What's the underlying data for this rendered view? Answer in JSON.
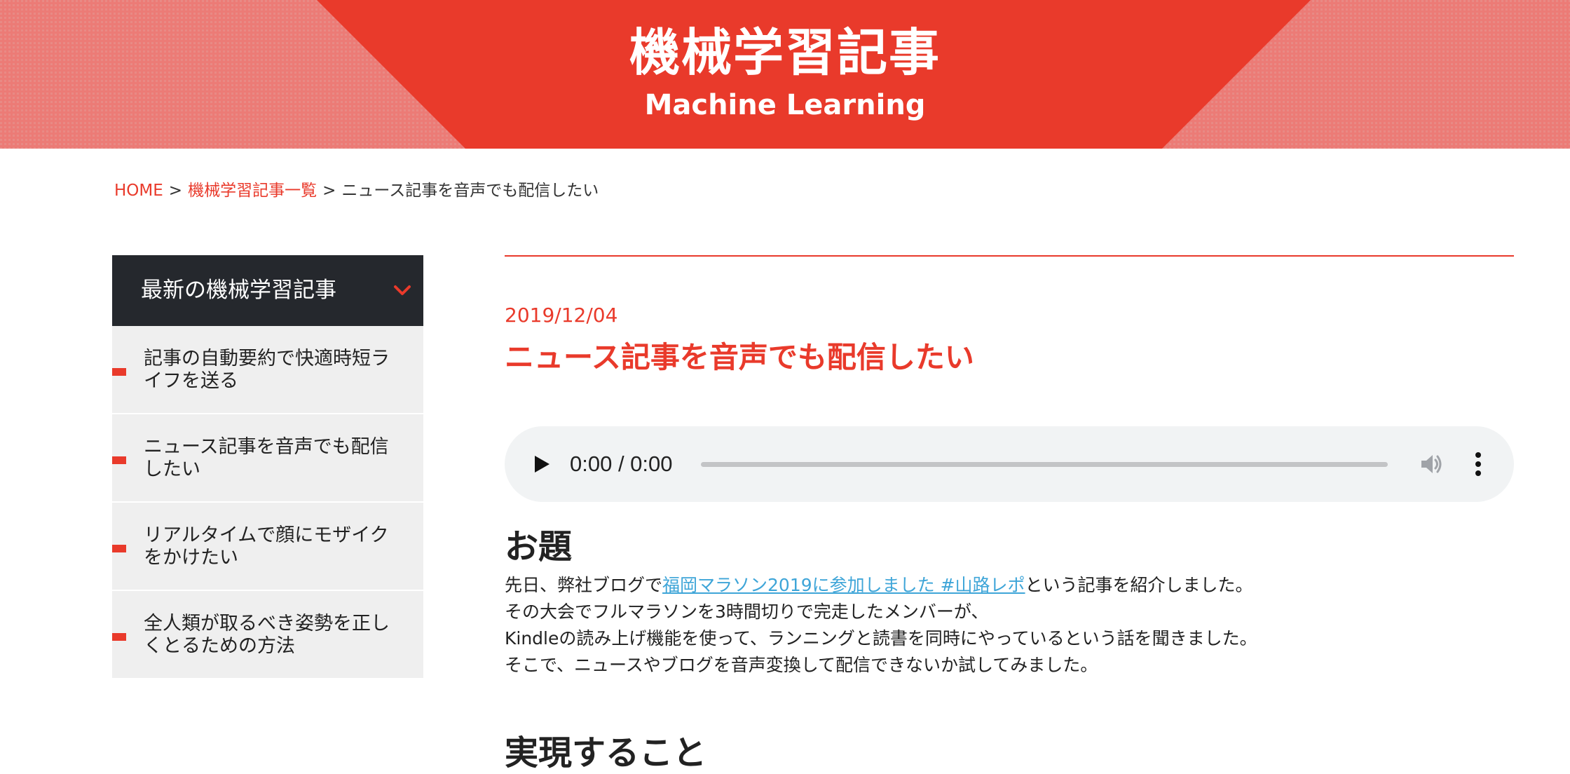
{
  "header": {
    "title": "機械学習記事",
    "subtitle": "Machine Learning"
  },
  "breadcrumb": {
    "home": "HOME",
    "separator": ">",
    "category": "機械学習記事一覧",
    "current": "ニュース記事を音声でも配信したい"
  },
  "sidebar": {
    "title": "最新の機械学習記事",
    "items": [
      {
        "label": "記事の自動要約で快適時短ライフを送る"
      },
      {
        "label": "ニュース記事を音声でも配信したい"
      },
      {
        "label": "リアルタイムで顔にモザイクをかけたい"
      },
      {
        "label": "全人類が取るべき姿勢を正しくとるための方法"
      }
    ]
  },
  "article": {
    "date": "2019/12/04",
    "title": "ニュース記事を音声でも配信したい",
    "player": {
      "time": "0:00 / 0:00",
      "progress": 0
    },
    "sections": [
      {
        "heading": "お題",
        "paragraph": {
          "line1_prefix": "先日、弊社ブログで",
          "line1_link": "福岡マラソン2019に参加しました #山路レポ",
          "line1_suffix": "という記事を紹介しました。",
          "line2": "その大会でフルマラソンを3時間切りで完走したメンバーが、",
          "line3": "Kindleの読み上げ機能を使って、ランニングと読書を同時にやっているという話を聞きました。",
          "line4": "そこで、ニュースやブログを音声変換して配信できないか試してみました。"
        }
      },
      {
        "heading": "実現すること"
      }
    ]
  },
  "colors": {
    "accent": "#e93a2b",
    "accent_light": "#ec7b76",
    "sidebar_head": "#25282d",
    "sidebar_item": "#efefef",
    "link": "#3ea5d8",
    "player_bg": "#f1f3f4"
  },
  "icons": {
    "sidebar_toggle": "chevron-down-icon",
    "play": "play-icon",
    "volume": "volume-icon",
    "menu": "more-vert-icon"
  }
}
